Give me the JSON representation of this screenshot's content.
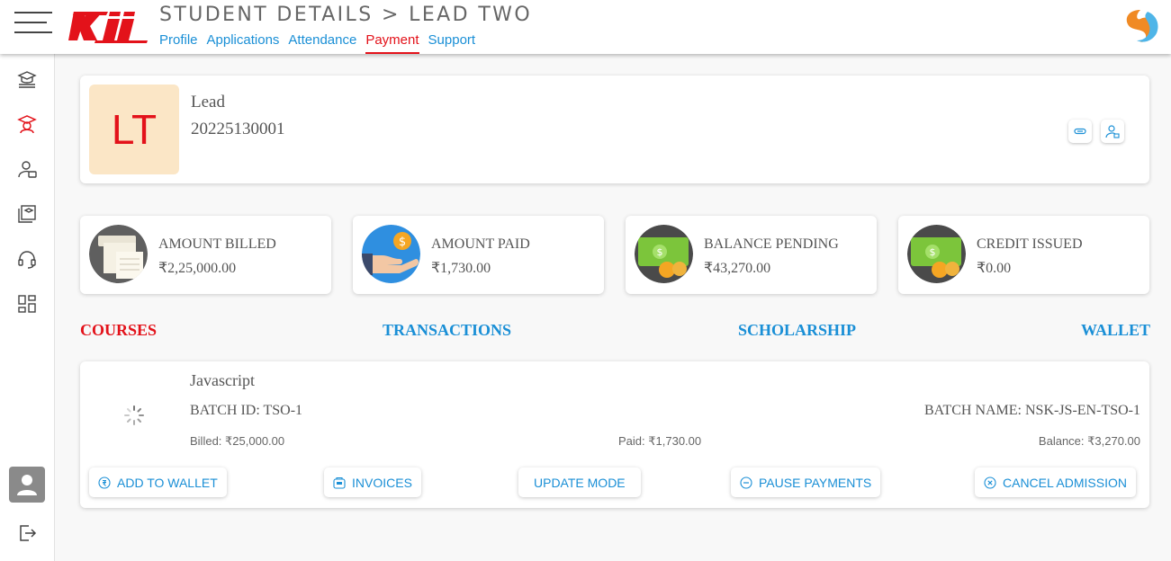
{
  "header": {
    "title": "STUDENT DETAILS > LEAD TWO",
    "logo_text": "Kii",
    "tabs": [
      {
        "label": "Profile",
        "active": false
      },
      {
        "label": "Applications",
        "active": false
      },
      {
        "label": "Attendance",
        "active": false
      },
      {
        "label": "Payment",
        "active": true
      },
      {
        "label": "Support",
        "active": false
      }
    ]
  },
  "sidebar": {
    "items": [
      {
        "icon": "courses-icon"
      },
      {
        "icon": "student-cap-icon",
        "active": true
      },
      {
        "icon": "user-card-icon"
      },
      {
        "icon": "library-icon"
      },
      {
        "icon": "headset-icon"
      },
      {
        "icon": "dashboard-grid-icon"
      }
    ],
    "bottom": [
      {
        "icon": "user-avatar-icon"
      },
      {
        "icon": "logout-icon"
      }
    ]
  },
  "profile": {
    "initials": "LT",
    "name": "Lead",
    "id": "20225130001"
  },
  "stats": [
    {
      "label": "AMOUNT BILLED",
      "value": "₹2,25,000.00",
      "icon": "bill-receipt-icon"
    },
    {
      "label": "AMOUNT PAID",
      "value": "₹1,730.00",
      "icon": "hand-coin-icon"
    },
    {
      "label": "BALANCE PENDING",
      "value": "₹43,270.00",
      "icon": "cash-coins-icon"
    },
    {
      "label": "CREDIT ISSUED",
      "value": "₹0.00",
      "icon": "cash-coins-icon"
    }
  ],
  "section_tabs": [
    {
      "label": "COURSES",
      "active": true
    },
    {
      "label": "TRANSACTIONS",
      "active": false
    },
    {
      "label": "SCHOLARSHIP",
      "active": false
    },
    {
      "label": "WALLET",
      "active": false
    }
  ],
  "course": {
    "name": "Javascript",
    "batch_id": "BATCH ID: TSO-1",
    "batch_name": "BATCH NAME: NSK-JS-EN-TSO-1",
    "billed": "Billed: ₹25,000.00",
    "paid": "Paid: ₹1,730.00",
    "balance": "Balance: ₹3,270.00",
    "actions": [
      {
        "label": "ADD TO WALLET",
        "icon": "rupee-circle-icon"
      },
      {
        "label": "INVOICES",
        "icon": "invoice-box-icon"
      },
      {
        "label": "UPDATE MODE",
        "icon": ""
      },
      {
        "label": "PAUSE PAYMENTS",
        "icon": "minus-circle-icon"
      },
      {
        "label": "CANCEL ADMISSION",
        "icon": "x-circle-icon"
      }
    ]
  },
  "colors": {
    "accent_red": "#e3121a",
    "link_blue": "#1a8fd6"
  }
}
